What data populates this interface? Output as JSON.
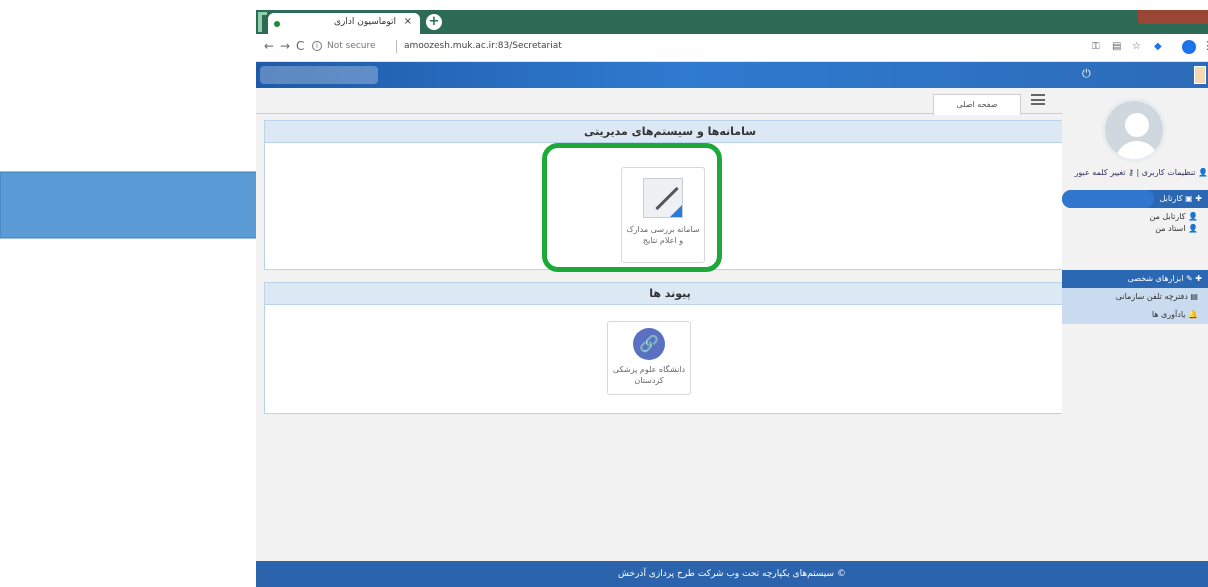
{
  "browser": {
    "tab_title": "اتوماسیون اداری",
    "tab_close": "×",
    "new_tab": "+",
    "window_title": "",
    "nav_back": "←",
    "nav_forward": "→",
    "nav_reload": "C",
    "secure_label": "Not secure",
    "url": "amoozesh.muk.ac.ir:83/Secretariat",
    "menu_dots": "⋮"
  },
  "tabs": {
    "home_label": "صفحه اصلی"
  },
  "panels": {
    "systems_title": "سامانه‌ها و سیستم‌های مدیریتی",
    "docs_tile_caption": "سامانه بررسی مدارک و اعلام نتایج",
    "links_title": "پیوند ها",
    "link_tile_caption": "دانشگاه علوم پزشکی کردستان"
  },
  "sidebar": {
    "user_settings": "تنظیمات کاربری",
    "change_password": "تغییر کلمه عبور",
    "inbox_label": "کارتابل",
    "item_staff": "کارتابل من",
    "item_professor": "استاد من",
    "tools_label": "ابزارهای شخصی",
    "tool_phonebook": "دفترچه تلفن سازمانی",
    "tool_reminders": "یادآوری ها"
  },
  "footer": {
    "text": "سیستم‌های یکپارچه تحت وب شرکت طرح پردازی آذرخش"
  },
  "colors": {
    "tabstrip": "#2e6b56",
    "header_blue": "#2a68b3",
    "highlight_green": "#1da83a",
    "arrow_blue": "#5b9bd5"
  },
  "icons": {
    "arrow": "annotation-arrow-icon",
    "power": "power-icon",
    "link": "link-icon"
  }
}
